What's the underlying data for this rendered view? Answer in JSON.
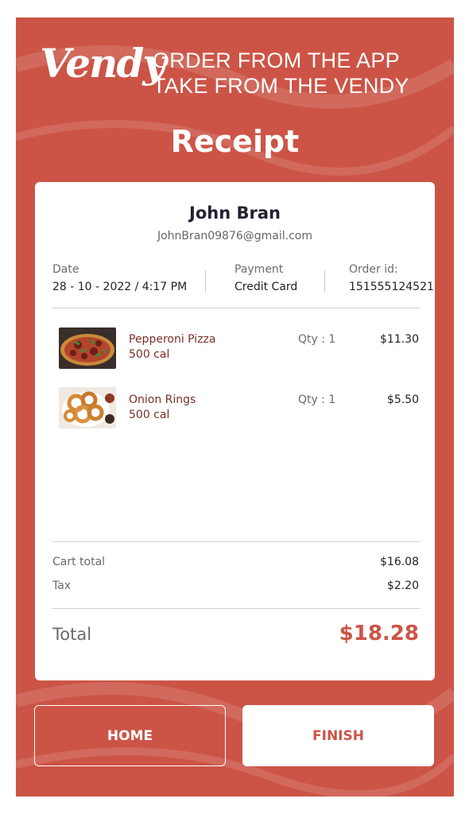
{
  "brand": {
    "logo": "Vendy",
    "tagline": "ORDER FROM THE APP TAKE FROM THE VENDY"
  },
  "page": {
    "title": "Receipt"
  },
  "customer": {
    "name": "John Bran",
    "email": "JohnBran09876@gmail.com"
  },
  "meta": {
    "date_label": "Date",
    "date_value": "28 - 10 - 2022 / 4:17 PM",
    "payment_label": "Payment",
    "payment_value": "Credit Card",
    "order_label": "Order id:",
    "order_value": "151555124521"
  },
  "items": [
    {
      "name": "Pepperoni Pizza",
      "cal": "500 cal",
      "qty": "Qty : 1",
      "price": "$11.30",
      "image": "pizza-image"
    },
    {
      "name": "Onion Rings",
      "cal": "500 cal",
      "qty": "Qty : 1",
      "price": "$5.50",
      "image": "onion-rings-image"
    }
  ],
  "summary": {
    "cart_total_label": "Cart total",
    "cart_total_value": "$16.08",
    "tax_label": "Tax",
    "tax_value": "$2.20",
    "total_label": "Total",
    "total_value": "$18.28"
  },
  "actions": {
    "home_label": "HOME",
    "finish_label": "FINISH"
  },
  "colors": {
    "accent": "#cc5446",
    "item_text": "#7a3028"
  }
}
